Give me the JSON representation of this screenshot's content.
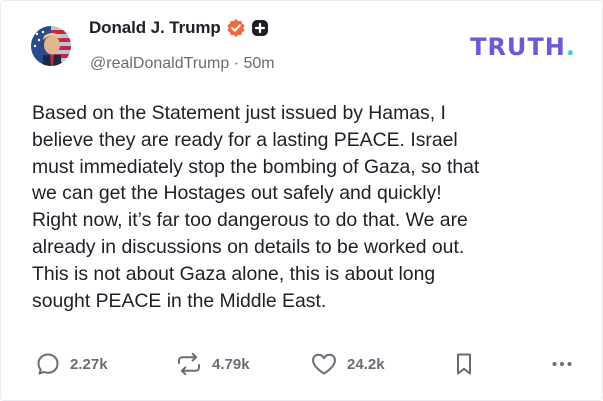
{
  "post": {
    "author_name": "Donald J. Trump",
    "handle": "@realDonaldTrump",
    "separator": "·",
    "time_ago": "50m",
    "brand": "TRUTH",
    "brand_dot": ".",
    "lines": [
      "Based on the Statement just issued by Hamas, I",
      "believe they are ready for a lasting PEACE. Israel",
      "must immediately stop the bombing of Gaza, so that",
      "we can get the Hostages out safely and quickly!",
      "Right now, it’s far too dangerous to do that. We are",
      "already in discussions on details to be worked out.",
      "This is not about Gaza alone, this is about long",
      "sought PEACE in the Middle East."
    ]
  },
  "actions": {
    "replies": "2.27k",
    "retruths": "4.79k",
    "likes": "24.2k"
  },
  "icons": [
    "avatar",
    "verified-badge-icon",
    "plus-badge-icon",
    "reply-icon",
    "retruth-icon",
    "like-icon",
    "bookmark-icon",
    "more-icon"
  ],
  "colors": {
    "brand": "#6a5ad8",
    "brand_dot": "#3fd1c0",
    "verified": "#ef6b48",
    "text": "#1f1f29",
    "muted": "#6b6b78"
  }
}
